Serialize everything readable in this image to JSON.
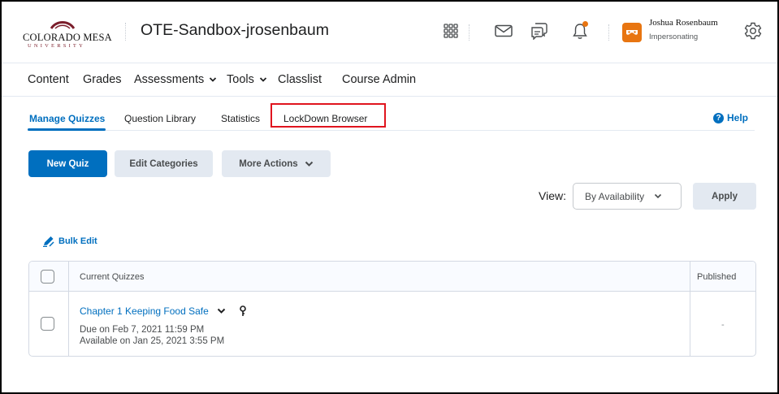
{
  "header": {
    "logo_text": "COLORADO MESA",
    "logo_sub": "UNIVERSITY",
    "course_title": "OTE-Sandbox-jrosenbaum",
    "icons": [
      "grid-icon",
      "mail-icon",
      "chat-icon",
      "bell-icon",
      "gear-icon"
    ],
    "user_name": "Joshua Rosenbaum",
    "user_status": "Impersonating",
    "accent_color": "#e87511"
  },
  "nav": {
    "items": [
      {
        "label": "Content"
      },
      {
        "label": "Grades"
      },
      {
        "label": "Assessments",
        "dropdown": true
      },
      {
        "label": "Tools",
        "dropdown": true
      },
      {
        "label": "Classlist"
      },
      {
        "label": "Course Admin"
      }
    ]
  },
  "tabs": {
    "items": [
      {
        "label": "Manage Quizzes",
        "active": true
      },
      {
        "label": "Question Library"
      },
      {
        "label": "Statistics"
      },
      {
        "label": "LockDown Browser",
        "highlighted": true
      }
    ],
    "help_label": "Help"
  },
  "toolbar": {
    "new_quiz": "New Quiz",
    "edit_categories": "Edit Categories",
    "more_actions": "More Actions",
    "view_label": "View:",
    "view_value": "By Availability",
    "apply": "Apply",
    "bulk_edit": "Bulk Edit"
  },
  "table": {
    "headers": {
      "title": "Current Quizzes",
      "published": "Published"
    },
    "rows": [
      {
        "name": "Chapter 1 Keeping Food Safe",
        "due": "Due on Feb 7, 2021 11:59 PM",
        "available": "Available on Jan 25, 2021 3:55 PM",
        "published": "-"
      }
    ]
  },
  "colors": {
    "primary": "#006fbf",
    "highlight_box": "#e0141e"
  }
}
